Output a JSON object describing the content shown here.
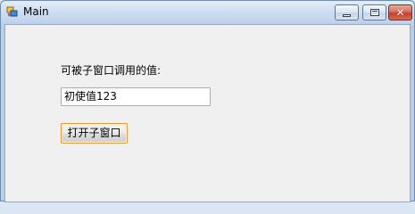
{
  "window": {
    "title": "Main",
    "controls": {
      "minimize_icon": "minimize-icon",
      "maximize_icon": "maximize-icon",
      "close_glyph": "✕"
    }
  },
  "form": {
    "label": "可被子窗口调用的值:",
    "textbox_value": "初使值123",
    "button_label": "打开子窗口"
  },
  "colors": {
    "close_button": "#c2412b",
    "client_background": "#f0f0f0",
    "focus_border": "#e39b2b"
  }
}
